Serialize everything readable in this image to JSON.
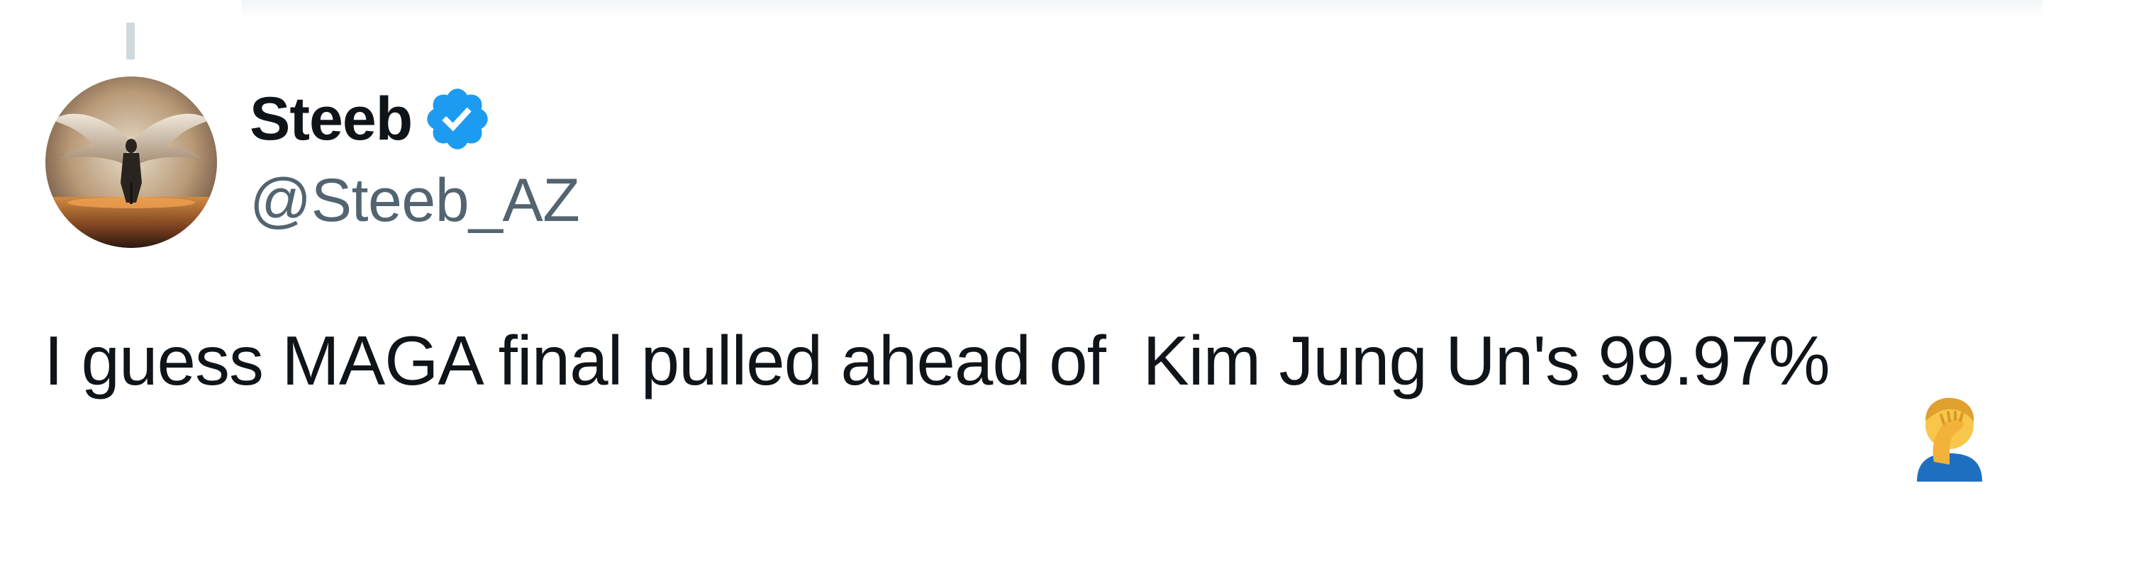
{
  "tweet": {
    "author": {
      "display_name": "Steeb",
      "handle": "@Steeb_AZ",
      "verified": true,
      "verified_icon": "verified-badge-icon",
      "avatar": "avatar-winged-figure"
    },
    "text": "I guess MAGA final pulled ahead of  Kim Jung Un's 99.97%",
    "emoji": "facepalm-emoji"
  },
  "colors": {
    "text": "#0f1419",
    "secondary_text": "#536471",
    "verified_blue": "#1d9bf0",
    "thread_line": "#cfd9de"
  }
}
